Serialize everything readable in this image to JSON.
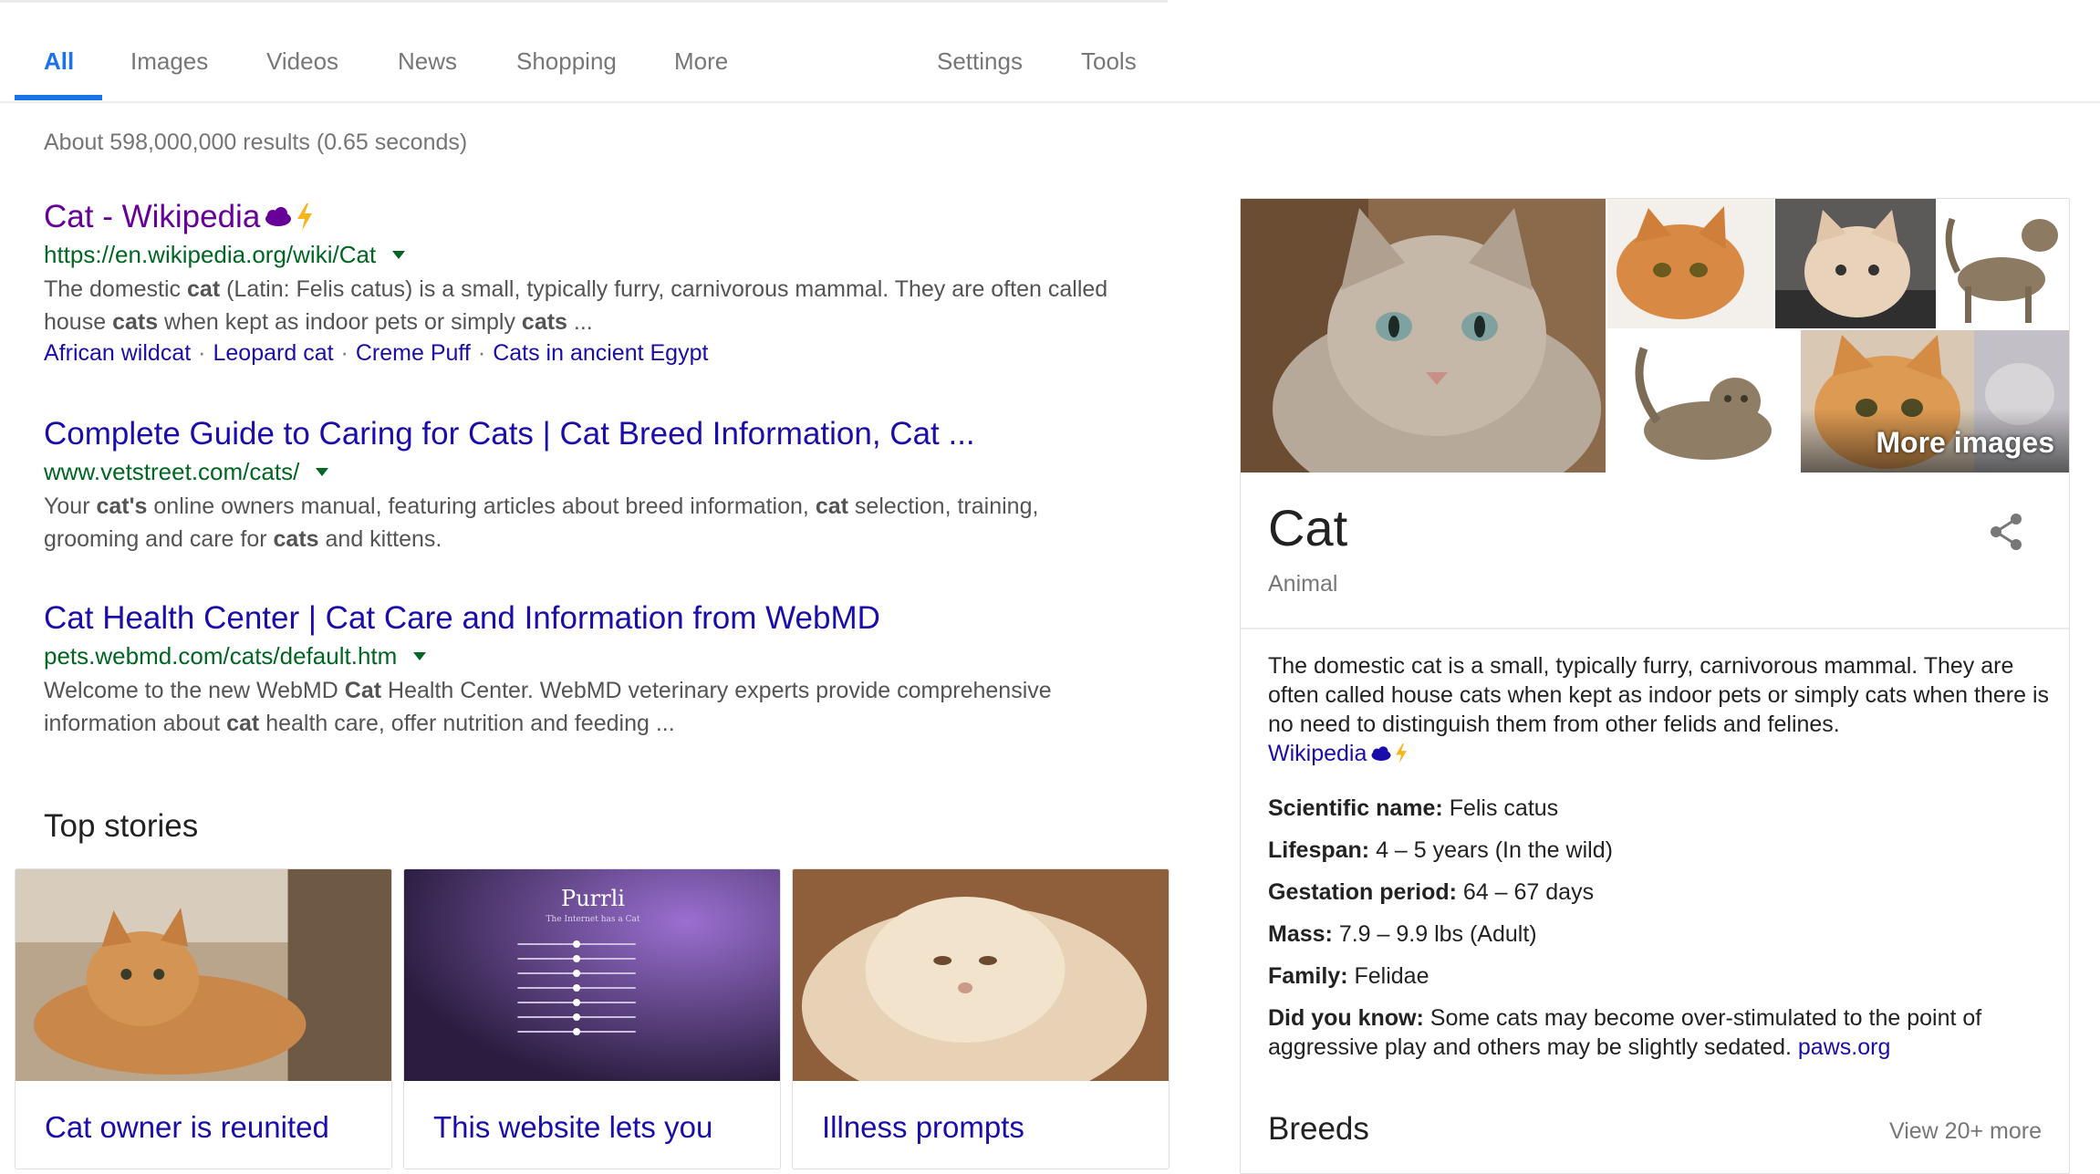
{
  "tabs": {
    "items": [
      {
        "label": "All",
        "active": true
      },
      {
        "label": "Images"
      },
      {
        "label": "Videos"
      },
      {
        "label": "News"
      },
      {
        "label": "Shopping"
      },
      {
        "label": "More"
      }
    ],
    "settings_label": "Settings",
    "tools_label": "Tools",
    "accent_color": "#1a73e8"
  },
  "stats": "About 598,000,000 results (0.65 seconds)",
  "results": [
    {
      "title": "Cat - Wikipedia",
      "url": "https://en.wikipedia.org/wiki/Cat",
      "snippet_parts": [
        {
          "t": "The domestic "
        },
        {
          "t": "cat",
          "b": true
        },
        {
          "t": " (Latin: Felis catus) is a small, typically furry, carnivorous mammal. They are often called house "
        },
        {
          "t": "cats",
          "b": true
        },
        {
          "t": " when kept as indoor pets or simply "
        },
        {
          "t": "cats",
          "b": true
        },
        {
          "t": " ..."
        }
      ],
      "sitelinks": [
        "African wildcat",
        "Leopard cat",
        "Creme Puff",
        "Cats in ancient Egypt"
      ],
      "visited": true,
      "amp": true
    },
    {
      "title": "Complete Guide to Caring for Cats | Cat Breed Information, Cat ...",
      "url": "www.vetstreet.com/cats/",
      "snippet_parts": [
        {
          "t": "Your "
        },
        {
          "t": "cat's",
          "b": true
        },
        {
          "t": " online owners manual, featuring articles about breed information, "
        },
        {
          "t": "cat",
          "b": true
        },
        {
          "t": " selection, training, grooming and care for "
        },
        {
          "t": "cats",
          "b": true
        },
        {
          "t": " and kittens."
        }
      ]
    },
    {
      "title": "Cat Health Center | Cat Care and Information from WebMD",
      "url": "pets.webmd.com/cats/default.htm",
      "snippet_parts": [
        {
          "t": "Welcome to the new WebMD "
        },
        {
          "t": "Cat",
          "b": true
        },
        {
          "t": " Health Center. WebMD veterinary experts provide comprehensive information about "
        },
        {
          "t": "cat",
          "b": true
        },
        {
          "t": " health care, offer nutrition and feeding ..."
        }
      ]
    }
  ],
  "top_stories": {
    "title": "Top stories",
    "stories": [
      {
        "title": "Cat owner is reunited"
      },
      {
        "title": "This website lets you",
        "thumb_brand": "Purrli",
        "thumb_tagline": "The Internet has a Cat"
      },
      {
        "title": "Illness prompts"
      }
    ]
  },
  "knowledge_panel": {
    "more_images_label": "More images",
    "title": "Cat",
    "subtitle": "Animal",
    "description": "The domestic cat is a small, typically furry, carnivorous mammal. They are often called house cats when kept as indoor pets or simply cats when there is no need to distinguish them from other felids and felines.",
    "source_label": "Wikipedia",
    "facts": [
      {
        "label": "Scientific name:",
        "value": "Felis catus"
      },
      {
        "label": "Lifespan:",
        "value": "4 – 5 years (In the wild)"
      },
      {
        "label": "Gestation period:",
        "value": "64 – 67 days"
      },
      {
        "label": "Mass:",
        "value": "7.9 – 9.9 lbs (Adult)"
      },
      {
        "label": "Family:",
        "value": "Felidae"
      },
      {
        "label": "Did you know:",
        "value": "Some cats may become over-stimulated to the point of aggressive play and others may be slightly sedated.",
        "link": "paws.org"
      }
    ],
    "breeds_title": "Breeds",
    "breeds_more": "View 20+ more"
  }
}
